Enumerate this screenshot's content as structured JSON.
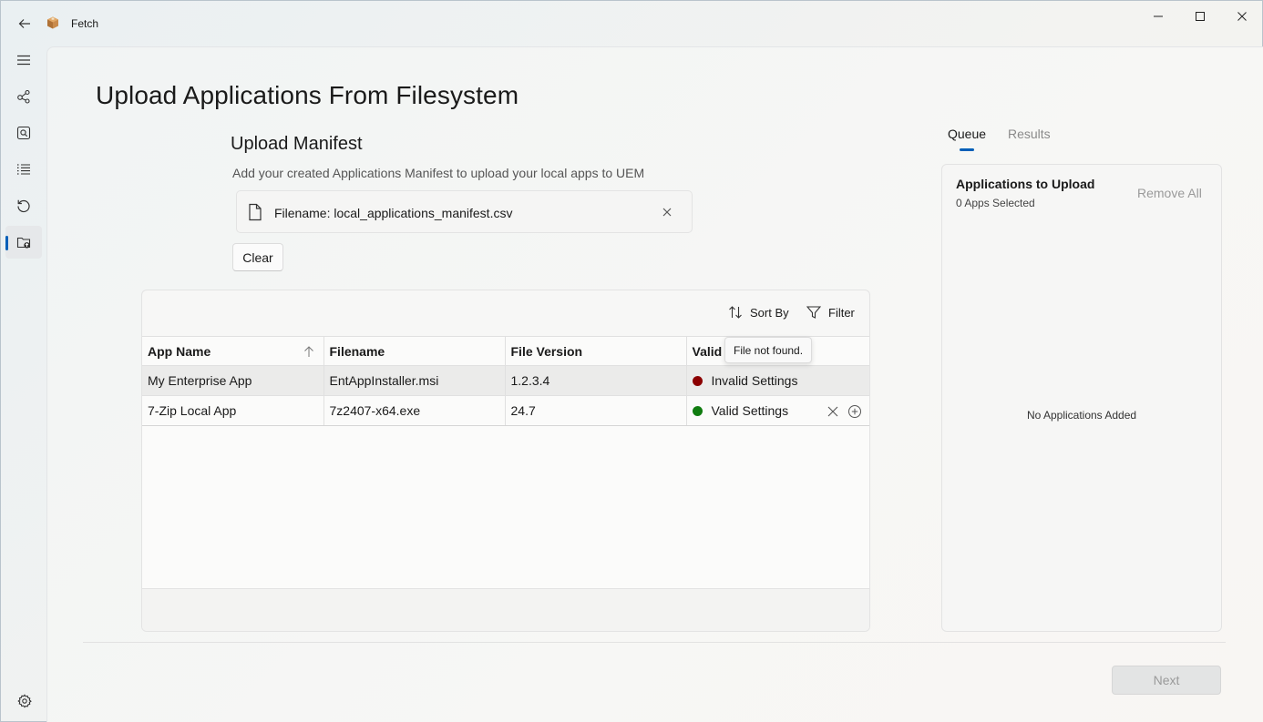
{
  "app": {
    "title": "Fetch",
    "icons": {
      "back": "back-arrow-icon",
      "app": "package-icon"
    }
  },
  "window_controls": {
    "minimize": "minimize-icon",
    "maximize": "maximize-icon",
    "close": "close-icon"
  },
  "nav": {
    "items": [
      {
        "name": "menu",
        "icon": "hamburger-icon"
      },
      {
        "name": "connections",
        "icon": "nodes-icon"
      },
      {
        "name": "search",
        "icon": "search-window-icon"
      },
      {
        "name": "list",
        "icon": "list-icon"
      },
      {
        "name": "history",
        "icon": "refresh-icon"
      },
      {
        "name": "upload",
        "icon": "folder-upload-icon",
        "active": true
      }
    ],
    "settings_icon": "gear-icon"
  },
  "page": {
    "title": "Upload Applications From Filesystem"
  },
  "manifest": {
    "title": "Upload Manifest",
    "description": "Add your created Applications Manifest to upload your local apps to UEM",
    "file_label": "Filename: local_applications_manifest.csv",
    "clear_label": "Clear"
  },
  "grid": {
    "toolbar": {
      "sort_label": "Sort By",
      "filter_label": "Filter"
    },
    "columns": [
      "App Name",
      "Filename",
      "File Version",
      "Valid"
    ],
    "sorted_column": "App Name",
    "sort_direction": "ascending",
    "rows": [
      {
        "app_name": "My Enterprise App",
        "filename": "EntAppInstaller.msi",
        "version": "1.2.3.4",
        "status": "Invalid Settings",
        "status_color": "#8b0000"
      },
      {
        "app_name": "7-Zip Local App",
        "filename": "7z2407-x64.exe",
        "version": "24.7",
        "status": "Valid Settings",
        "status_color": "#107c10"
      }
    ],
    "tooltip": "File not found."
  },
  "queue": {
    "tabs": [
      "Queue",
      "Results"
    ],
    "active_tab": "Queue",
    "title": "Applications to Upload",
    "count_label": "0 Apps Selected",
    "remove_all_label": "Remove All",
    "empty_label": "No Applications Added"
  },
  "footer": {
    "next_label": "Next"
  },
  "colors": {
    "accent": "#005fb8",
    "invalid": "#8b0000",
    "valid": "#107c10"
  }
}
